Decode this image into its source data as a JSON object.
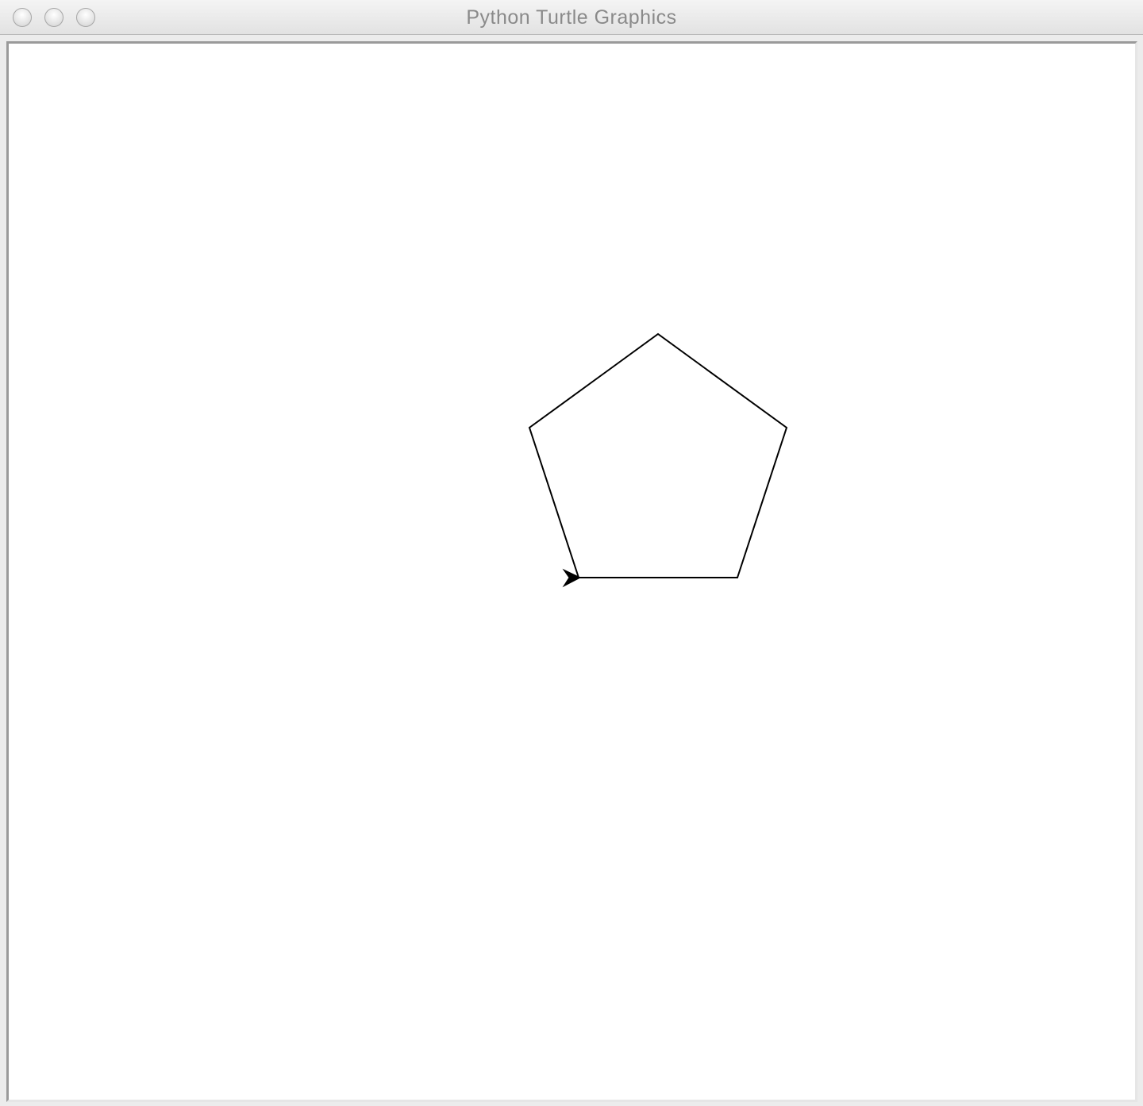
{
  "window": {
    "title": "Python Turtle Graphics",
    "buttons": {
      "close": "close-icon",
      "minimize": "minimize-icon",
      "zoom": "zoom-icon"
    }
  },
  "canvas": {
    "background": "#ffffff",
    "drawing": {
      "shape": "pentagon",
      "sides": 5,
      "pen_color": "#000000"
    },
    "turtle": {
      "shape": "arrow",
      "heading": "east",
      "color": "#000000"
    }
  }
}
